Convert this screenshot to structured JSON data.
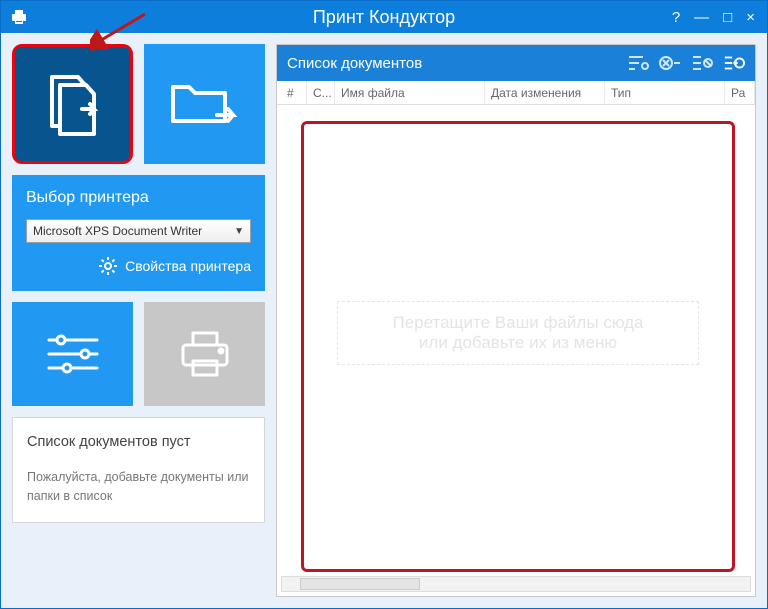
{
  "window": {
    "title": "Принт Кондуктор",
    "help": "?",
    "minimize": "—",
    "maximize": "□",
    "close": "×"
  },
  "printer": {
    "heading": "Выбор принтера",
    "selected": "Microsoft XPS Document Writer",
    "props_label": "Свойства принтера"
  },
  "status": {
    "title": "Список документов пуст",
    "body": "Пожалуйста, добавьте документы или папки в список"
  },
  "docs": {
    "header_title": "Список документов",
    "columns": {
      "num": "#",
      "status": "С...",
      "name": "Имя файла",
      "date": "Дата изменения",
      "type": "Тип",
      "size": "Ра"
    },
    "drop_line1": "Перетащите Ваши файлы сюда",
    "drop_line2": "или добавьте их из меню"
  }
}
